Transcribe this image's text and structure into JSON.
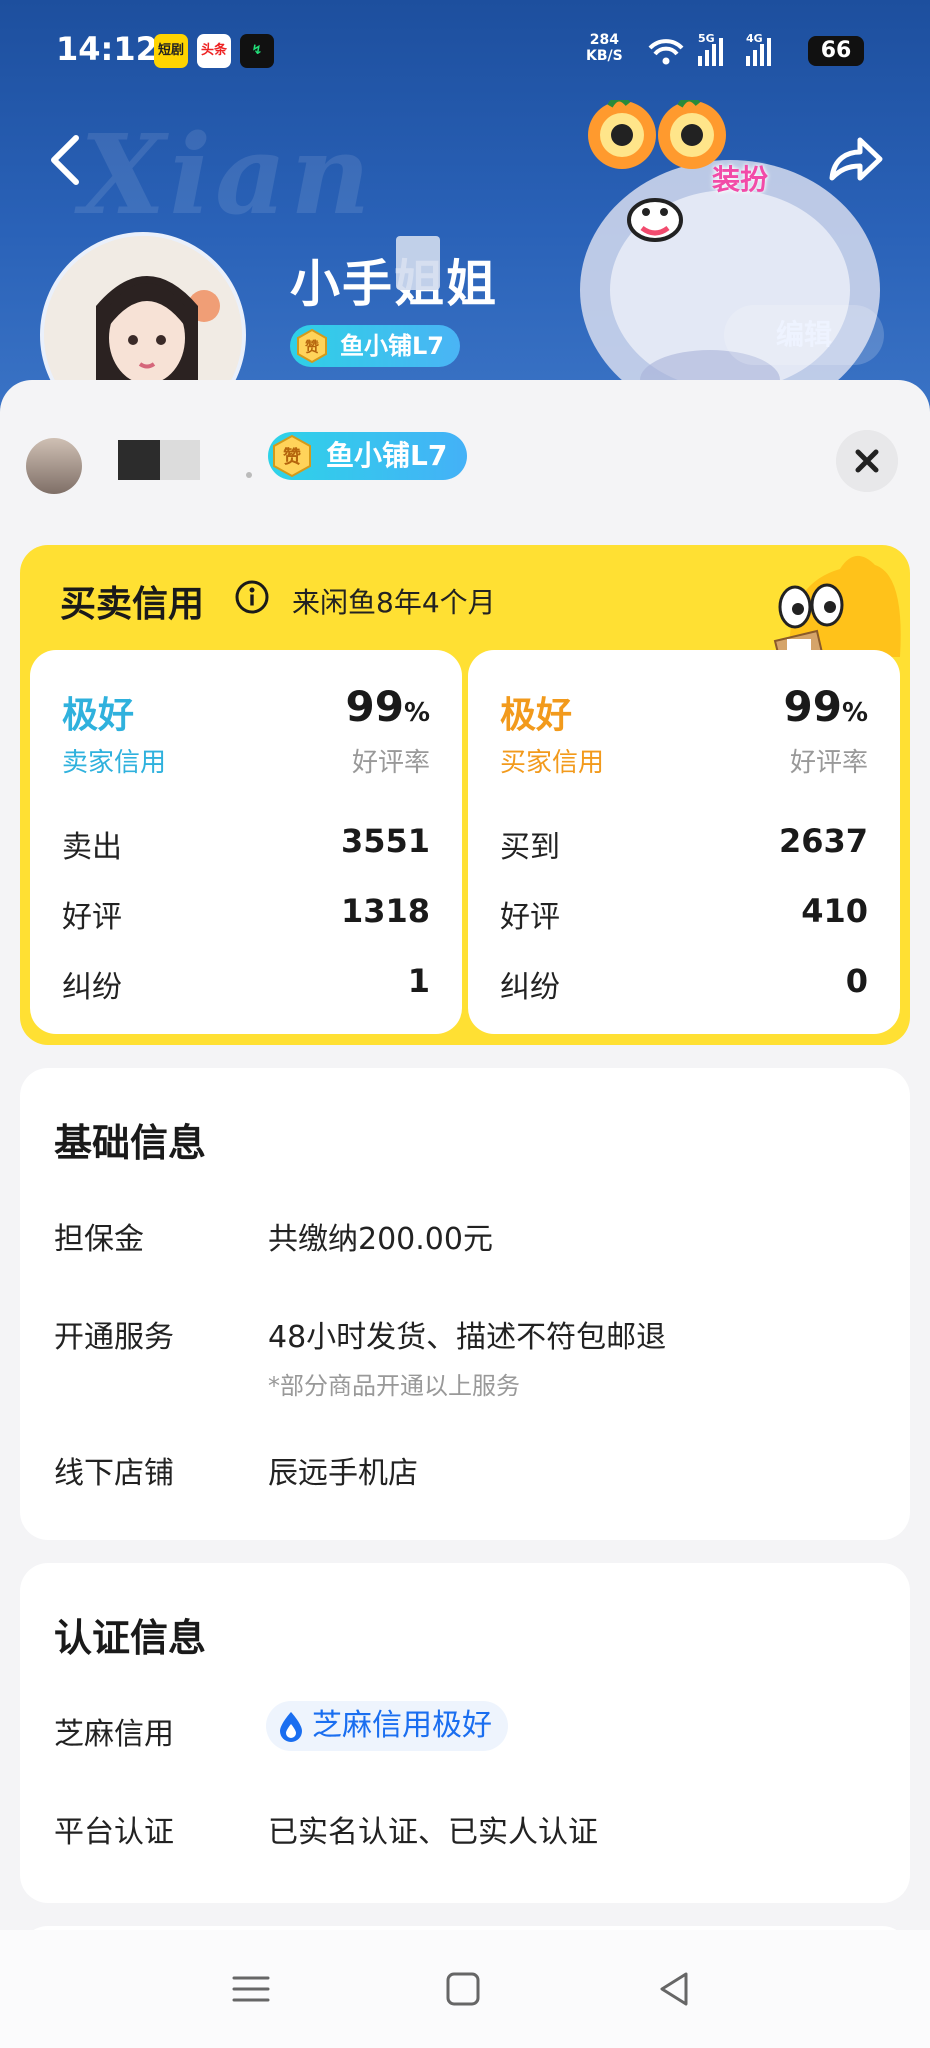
{
  "status_bar": {
    "time": "14:12",
    "app_icons": [
      "短剧",
      "头条",
      "↯"
    ],
    "net_speed_value": "284",
    "net_speed_unit": "KB/S",
    "signal_1": "5G",
    "signal_2": "4G",
    "battery": "66"
  },
  "profile": {
    "watermark": "Xian",
    "nickname": "小手姐姐",
    "shop_badge": "鱼小铺L7",
    "badge_coin": "赞",
    "dress_up_label": "装扮",
    "edit_label": "编辑"
  },
  "sheet": {
    "shop_badge": "鱼小铺L7",
    "badge_coin": "赞",
    "credit": {
      "title": "买卖信用",
      "age": "来闲鱼8年4个月",
      "seller": {
        "grade": "极好",
        "grade_label": "卖家信用",
        "rate": "99",
        "rate_unit": "%",
        "rate_label": "好评率",
        "stats": [
          {
            "label": "卖出",
            "value": "3551"
          },
          {
            "label": "好评",
            "value": "1318"
          },
          {
            "label": "纠纷",
            "value": "1"
          }
        ]
      },
      "buyer": {
        "grade": "极好",
        "grade_label": "买家信用",
        "rate": "99",
        "rate_unit": "%",
        "rate_label": "好评率",
        "stats": [
          {
            "label": "买到",
            "value": "2637"
          },
          {
            "label": "好评",
            "value": "410"
          },
          {
            "label": "纠纷",
            "value": "0"
          }
        ]
      }
    },
    "basic_info": {
      "title": "基础信息",
      "deposit_label": "担保金",
      "deposit_value": "共缴纳200.00元",
      "service_label": "开通服务",
      "service_value": "48小时发货、描述不符包邮退",
      "service_note": "*部分商品开通以上服务",
      "store_label": "线下店铺",
      "store_value": "辰远手机店"
    },
    "verify_info": {
      "title": "认证信息",
      "zhima_label": "芝麻信用",
      "zhima_value": "芝麻信用极好",
      "platform_label": "平台认证",
      "platform_value": "已实名认证、已实人认证"
    }
  },
  "colors": {
    "header_blue": "#2a62b8",
    "credit_yellow": "#ffe033",
    "seller_blue": "#2fb1dd",
    "buyer_orange": "#f29a1c",
    "badge_cyan": "#2ed3e8",
    "zhima_blue": "#1a6ef0"
  },
  "icons": [
    "back-icon",
    "share-icon",
    "close-icon",
    "info-icon",
    "zhima-icon",
    "menu-icon",
    "home-icon",
    "back-nav-icon"
  ]
}
